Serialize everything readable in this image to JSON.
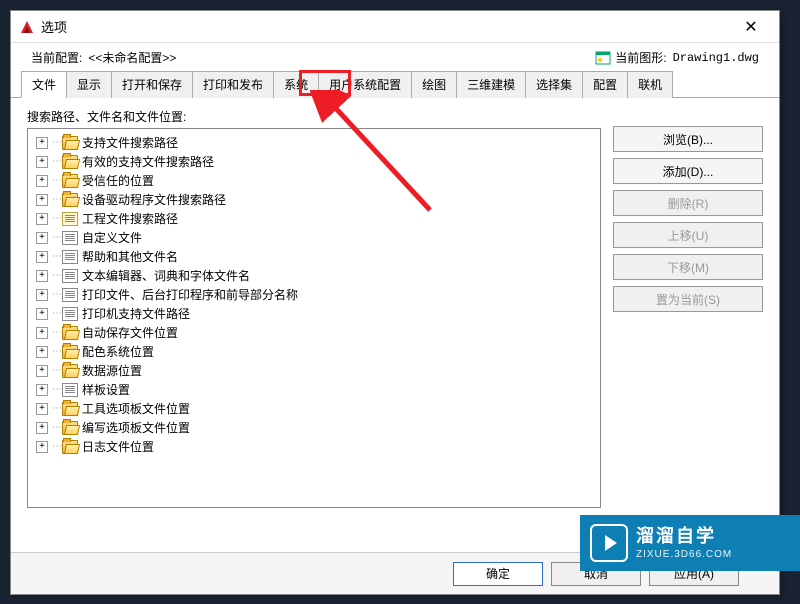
{
  "window": {
    "title": "选项"
  },
  "header": {
    "current_config_label": "当前配置:",
    "current_config_value": "<<未命名配置>>",
    "current_drawing_label": "当前图形:",
    "current_drawing_value": "Drawing1.dwg"
  },
  "tabs": [
    {
      "label": "文件",
      "active": true
    },
    {
      "label": "显示"
    },
    {
      "label": "打开和保存"
    },
    {
      "label": "打印和发布"
    },
    {
      "label": "系统"
    },
    {
      "label": "用户系统配置"
    },
    {
      "label": "绘图"
    },
    {
      "label": "三维建模"
    },
    {
      "label": "选择集"
    },
    {
      "label": "配置"
    },
    {
      "label": "联机"
    }
  ],
  "tree": {
    "label": "搜索路径、文件名和文件位置:",
    "items": [
      {
        "icon": "folder-open",
        "label": "支持文件搜索路径"
      },
      {
        "icon": "folder-open",
        "label": "有效的支持文件搜索路径"
      },
      {
        "icon": "folder-open",
        "label": "受信任的位置"
      },
      {
        "icon": "folder-open",
        "label": "设备驱动程序文件搜索路径"
      },
      {
        "icon": "doc-yellow",
        "label": "工程文件搜索路径"
      },
      {
        "icon": "doc",
        "label": "自定义文件"
      },
      {
        "icon": "doc",
        "label": "帮助和其他文件名"
      },
      {
        "icon": "doc",
        "label": "文本编辑器、词典和字体文件名"
      },
      {
        "icon": "doc",
        "label": "打印文件、后台打印程序和前导部分名称"
      },
      {
        "icon": "doc",
        "label": "打印机支持文件路径"
      },
      {
        "icon": "folder-open",
        "label": "自动保存文件位置"
      },
      {
        "icon": "folder-open",
        "label": "配色系统位置"
      },
      {
        "icon": "folder-open",
        "label": "数据源位置"
      },
      {
        "icon": "doc",
        "label": "样板设置"
      },
      {
        "icon": "folder-open",
        "label": "工具选项板文件位置"
      },
      {
        "icon": "folder-open",
        "label": "编写选项板文件位置"
      },
      {
        "icon": "folder-open",
        "label": "日志文件位置"
      }
    ]
  },
  "side_buttons": {
    "browse": "浏览(B)...",
    "add": "添加(D)...",
    "delete": "删除(R)",
    "moveup": "上移(U)",
    "movedown": "下移(M)",
    "setcurrent": "置为当前(S)"
  },
  "bottom_buttons": {
    "ok": "确定",
    "cancel": "取消",
    "apply": "应用(A)"
  },
  "watermark": {
    "main": "溜溜自学",
    "sub": "ZIXUE.3D66.COM"
  }
}
